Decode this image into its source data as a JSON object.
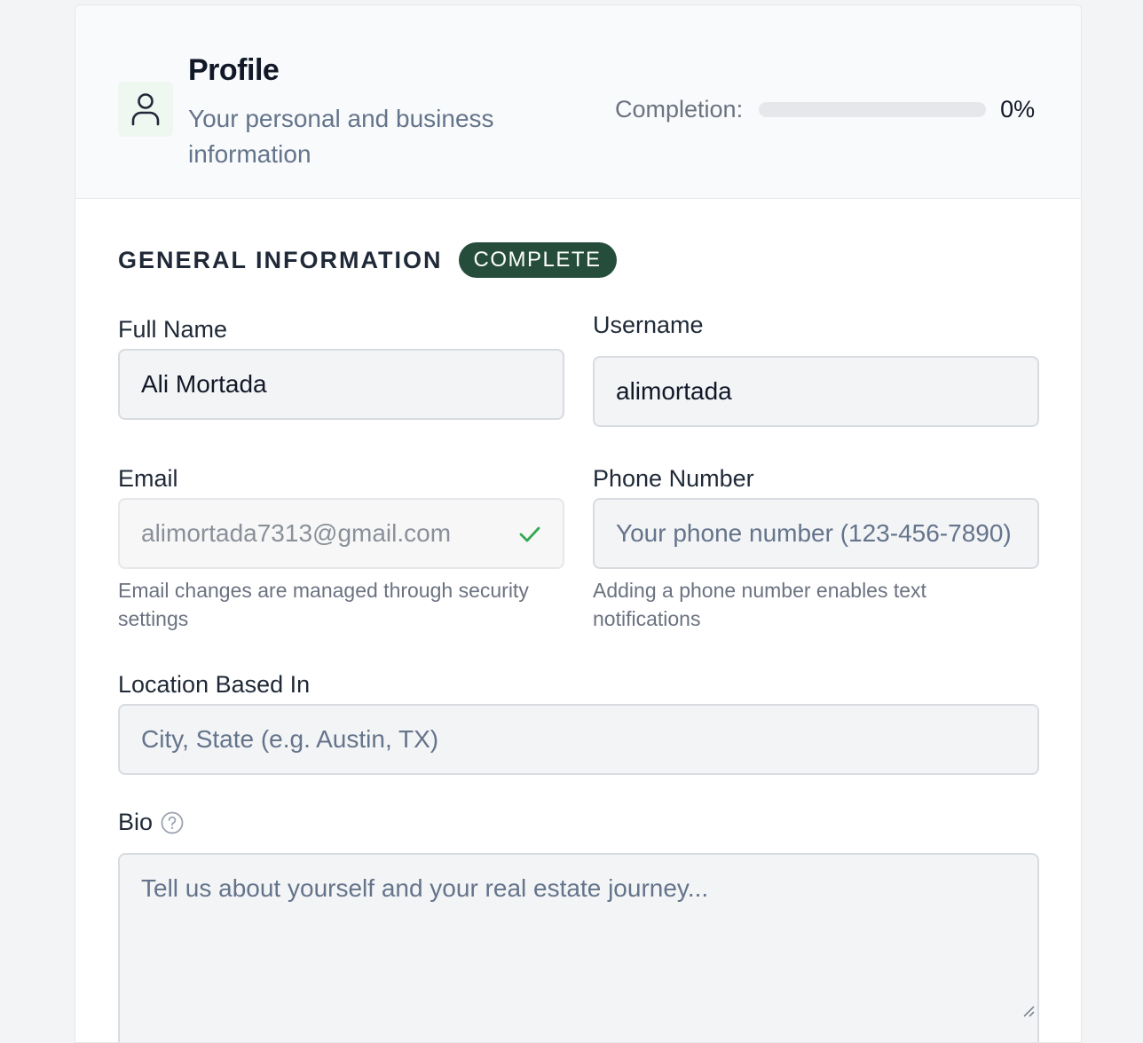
{
  "header": {
    "icon": "user-icon",
    "title": "Profile",
    "subtitle": "Your personal and business information",
    "completion_label": "Completion:",
    "completion_value": "0%",
    "completion_fraction": 0
  },
  "section": {
    "title": "GENERAL INFORMATION",
    "badge": "COMPLETE"
  },
  "fields": {
    "full_name": {
      "label": "Full Name",
      "value": "Ali Mortada"
    },
    "username": {
      "label": "Username",
      "value": "alimortada"
    },
    "email": {
      "label": "Email",
      "value": "alimortada7313@gmail.com",
      "hint": "Email changes are managed through security settings",
      "verified_icon": "check-icon"
    },
    "phone": {
      "label": "Phone Number",
      "placeholder": "Your phone number (123-456-7890)",
      "hint": "Adding a phone number enables text notifications"
    },
    "location": {
      "label": "Location Based In",
      "placeholder": "City, State (e.g. Austin, TX)"
    },
    "bio": {
      "label": "Bio",
      "help_icon": "question-circle-icon",
      "placeholder": "Tell us about yourself and your real estate journey..."
    }
  },
  "colors": {
    "badge_bg": "#264d3c",
    "check": "#34a853"
  }
}
